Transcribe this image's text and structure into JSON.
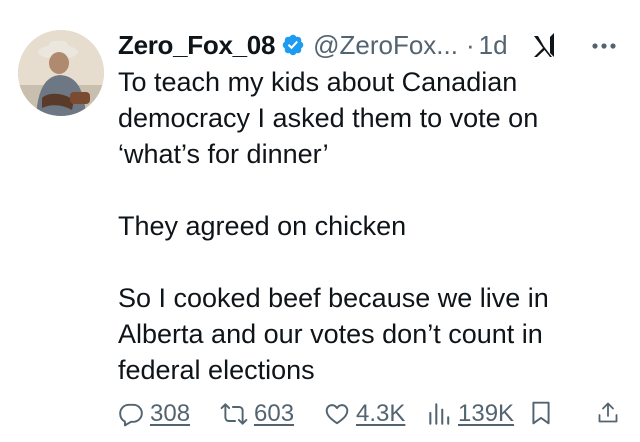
{
  "tweet": {
    "author_name": "Zero_Fox_08",
    "handle": "@ZeroFox...",
    "separator": "·",
    "time": "1d",
    "paragraphs": [
      "To teach my kids about Canadian democracy I asked them to vote on ‘what’s for dinner’",
      "They agreed on chicken",
      "So I cooked beef because we live in Alberta and our votes don’t count in federal elections"
    ]
  },
  "actions": {
    "replies": "308",
    "reposts": "603",
    "likes": "4.3K",
    "views": "139K"
  },
  "icons": {
    "verified": "verified-badge-icon",
    "grok": "grok-icon",
    "more": "more-icon",
    "reply": "reply-icon",
    "repost": "repost-icon",
    "like": "heart-icon",
    "views": "views-icon",
    "bookmark": "bookmark-icon",
    "share": "share-icon"
  },
  "colors": {
    "text": "#0f1419",
    "secondary": "#536471",
    "verified_blue": "#1d9bf0"
  }
}
